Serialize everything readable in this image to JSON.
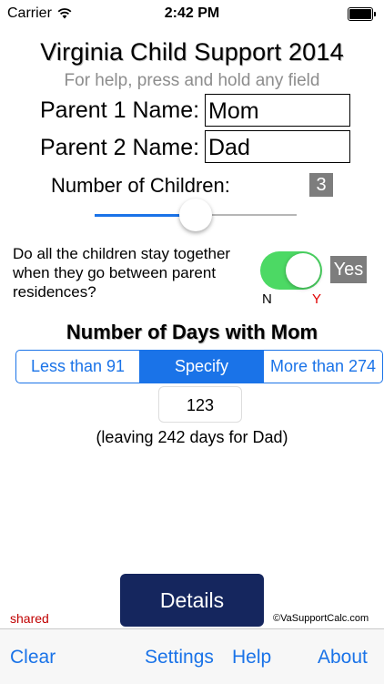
{
  "status_bar": {
    "carrier": "Carrier",
    "time": "2:42 PM"
  },
  "app": {
    "title": "Virginia Child Support 2014",
    "help_text": "For help, press and hold any field"
  },
  "parents": {
    "parent1_label": "Parent 1 Name:",
    "parent1_value": "Mom",
    "parent2_label": "Parent 2 Name:",
    "parent2_value": "Dad"
  },
  "children": {
    "label": "Number of Children:",
    "count": "3",
    "slider_fraction": 0.5
  },
  "together": {
    "question": "Do all the children stay together when they go between parent residences?",
    "toggle_on": true,
    "value_badge": "Yes",
    "no_label": "N",
    "yes_label": "Y"
  },
  "days": {
    "heading": "Number of Days with Mom",
    "segments": [
      "Less than 91",
      "Specify",
      "More than 274"
    ],
    "selected_segment": "Specify",
    "value": "123",
    "leaving_text": "(leaving 242 days for Dad)"
  },
  "footer": {
    "details_button": "Details",
    "shared_label": "shared",
    "copyright": "©VaSupportCalc.com"
  },
  "tabbar": {
    "clear": "Clear",
    "settings": "Settings",
    "help": "Help",
    "about": "About"
  },
  "colors": {
    "accent": "#1a73e8",
    "toggle_on": "#4cd964",
    "details_bg": "#15265e",
    "badge_bg": "#7d7d7d",
    "red": "#e00000"
  }
}
